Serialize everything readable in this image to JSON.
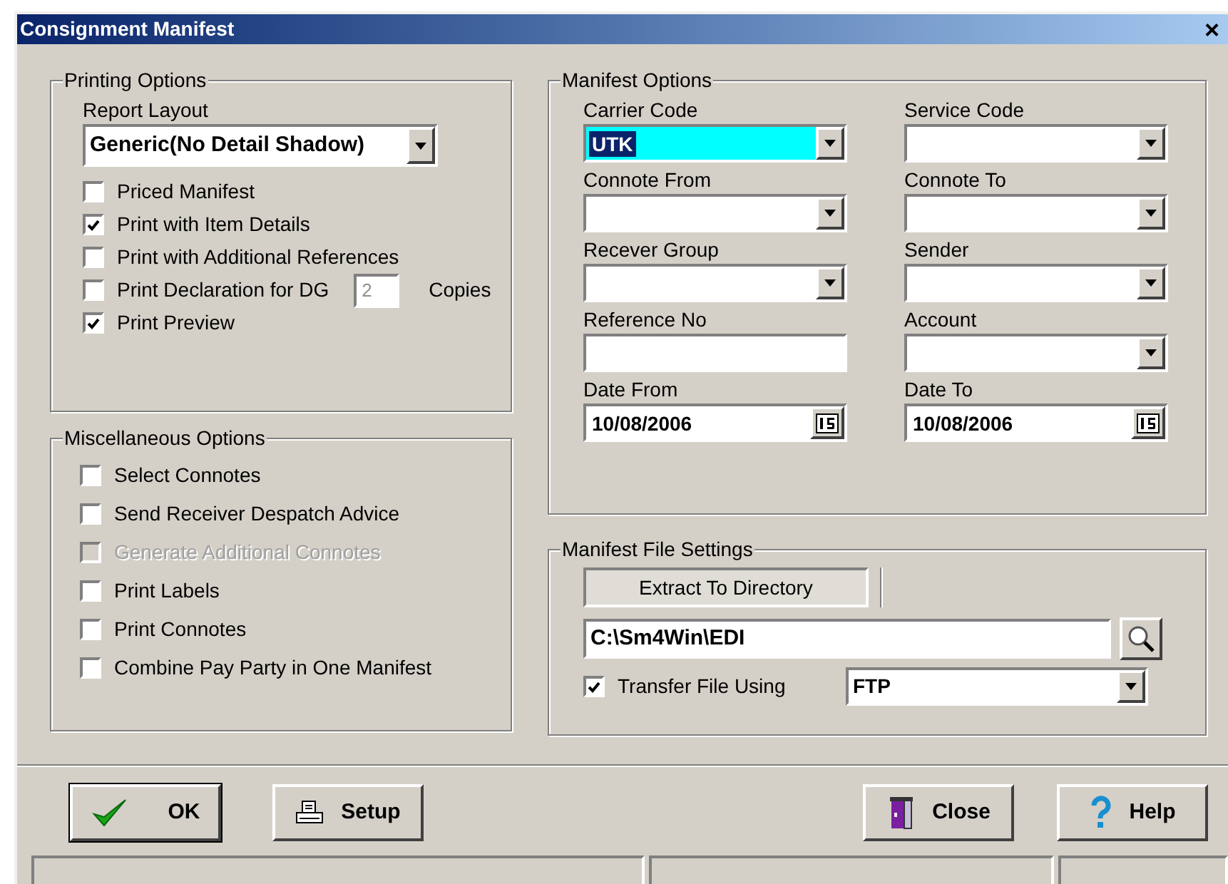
{
  "window": {
    "title": "Consignment Manifest",
    "close": "×"
  },
  "printing_options": {
    "title": "Printing Options",
    "report_layout": {
      "label": "Report Layout",
      "value": "Generic(No Detail Shadow)"
    },
    "checkboxes": [
      {
        "label": "Priced Manifest",
        "checked": false,
        "disabled": false
      },
      {
        "label": "Print with Item Details",
        "checked": true,
        "disabled": false
      },
      {
        "label": "Print with Additional References",
        "checked": false,
        "disabled": false
      },
      {
        "label": "Print Declaration for DG",
        "checked": false,
        "disabled": false,
        "copies": {
          "value": "2",
          "label": "Copies"
        }
      },
      {
        "label": "Print Preview",
        "checked": true,
        "disabled": false
      }
    ]
  },
  "miscellaneous_options": {
    "title": "Miscellaneous Options",
    "checkboxes": [
      {
        "label": "Select Connotes",
        "checked": false,
        "disabled": false
      },
      {
        "label": "Send Receiver Despatch Advice",
        "checked": false,
        "disabled": false
      },
      {
        "label": "Generate Additional Connotes",
        "checked": false,
        "disabled": true
      },
      {
        "label": "Print Labels",
        "checked": false,
        "disabled": false
      },
      {
        "label": "Print Connotes",
        "checked": false,
        "disabled": false
      },
      {
        "label": "Combine Pay Party in One Manifest",
        "checked": false,
        "disabled": false
      }
    ]
  },
  "manifest_options": {
    "title": "Manifest Options",
    "fields": [
      {
        "label": "Carrier Code",
        "kind": "combo",
        "value": "UTK",
        "selected": true
      },
      {
        "label": "Service Code",
        "kind": "combo",
        "selected": false
      },
      {
        "label": "Connote From",
        "kind": "combo",
        "selected": false
      },
      {
        "label": "Connote To",
        "kind": "combo",
        "selected": false
      },
      {
        "label": "Recever Group",
        "kind": "combo",
        "selected": false
      },
      {
        "label": "Sender",
        "kind": "combo",
        "selected": false
      },
      {
        "label": "Reference No",
        "kind": "text",
        "selected": false
      },
      {
        "label": "Account",
        "kind": "combo",
        "selected": false
      },
      {
        "label": "Date From",
        "kind": "date",
        "value": "10/08/2006",
        "selected": false
      },
      {
        "label": "Date To",
        "kind": "date",
        "value": "10/08/2006",
        "selected": false
      }
    ]
  },
  "manifest_file_settings": {
    "title": "Manifest File Settings",
    "tab": "Extract To Directory",
    "directory": "C:\\Sm4Win\\EDI",
    "transfer": {
      "label": "Transfer File Using",
      "checked": true,
      "method": "FTP"
    }
  },
  "buttons": [
    {
      "label": "OK",
      "kind": "ok"
    },
    {
      "label": "Setup",
      "kind": "setup"
    },
    {
      "label": "Close",
      "kind": "close"
    },
    {
      "label": "Help",
      "kind": "help"
    }
  ]
}
